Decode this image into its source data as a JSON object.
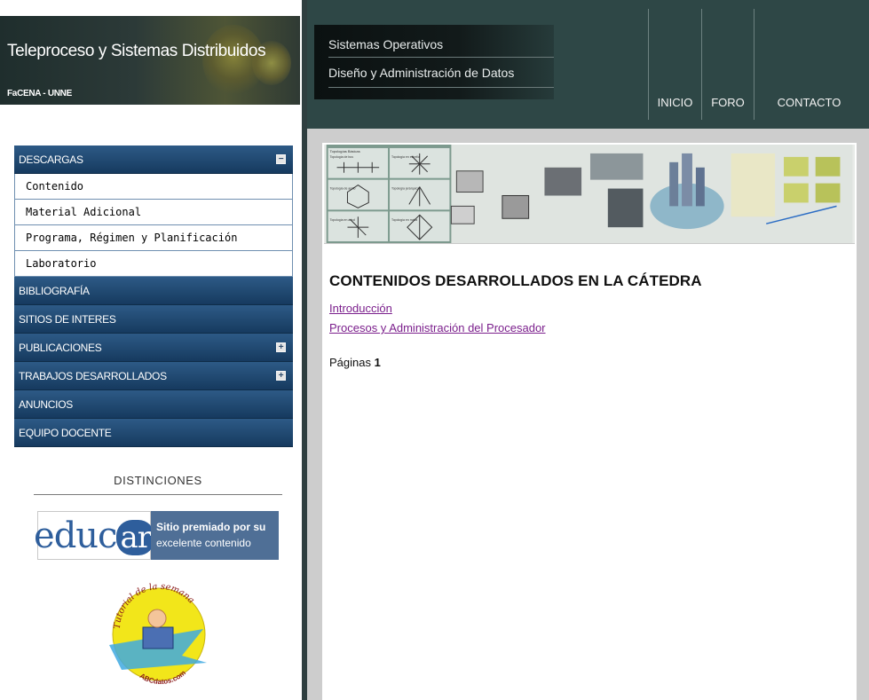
{
  "site": {
    "title": "Teleproceso y Sistemas Distribuidos",
    "subtitle": "FaCENA - UNNE"
  },
  "header": {
    "site_links": [
      "Sistemas Operativos",
      "Diseño y Administración de Datos"
    ],
    "nav": [
      "INICIO",
      "FORO",
      "CONTACTO"
    ]
  },
  "sidebar": {
    "descargas": {
      "label": "DESCARGAS",
      "toggle": "−"
    },
    "descargas_items": [
      "Contenido",
      "Material Adicional",
      "Programa, Régimen y Planificación",
      "Laboratorio"
    ],
    "bibliografia": "BIBLIOGRAFÍA",
    "sitios": "SITIOS DE INTERES",
    "publicaciones": {
      "label": "PUBLICACIONES",
      "toggle": "+"
    },
    "trabajos": {
      "label": "TRABAJOS DESARROLLADOS",
      "toggle": "+"
    },
    "anuncios": "ANUNCIOS",
    "equipo": "EQUIPO DOCENTE"
  },
  "distinciones": {
    "title": "DISTINCIONES",
    "educar": {
      "word_main": "educ",
      "word_badge": "ar",
      "award_line1": "Sitio premiado por su",
      "award_line2": "excelente contenido"
    },
    "tutorial": {
      "top": "Tutorial de la semana",
      "bottom": "ABCdatos.com"
    }
  },
  "main": {
    "heading": "CONTENIDOS DESARROLLADOS EN LA CÁTEDRA",
    "links": [
      "Introducción",
      "Procesos y Administración del Procesador"
    ],
    "pages_label": "Páginas",
    "pages_current": "1"
  },
  "banner": {
    "labels": [
      "Topologías Básicas",
      "Topología de bus",
      "Topología en estrella",
      "Topología de anillo",
      "Topología jerárquica",
      "Topología en árbol",
      "Topología en malla"
    ]
  },
  "colors": {
    "menu_blue": "#1f4a74",
    "header_teal": "#2e4746",
    "link_purple": "#7b1f8c"
  }
}
